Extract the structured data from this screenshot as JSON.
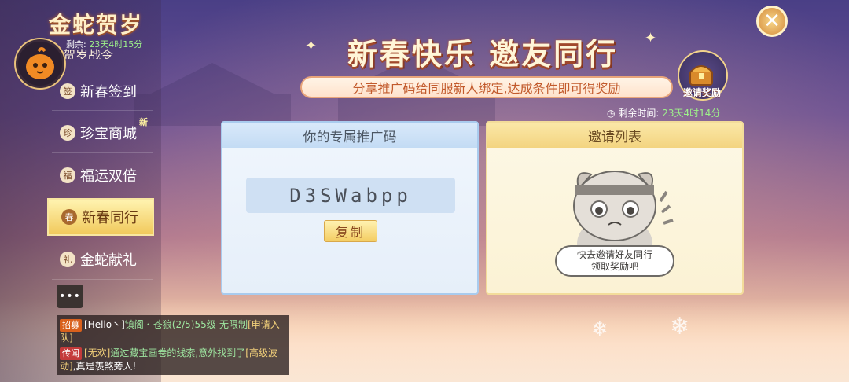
{
  "sidebar": {
    "title": "金蛇贺岁",
    "remaining_label": "剩余:",
    "remaining_value": "23天4时15分",
    "cut_off_item": "贺岁战令",
    "items": [
      {
        "label": "新春签到",
        "icon": "签"
      },
      {
        "label": "珍宝商城",
        "icon": "珍"
      },
      {
        "label": "福运双倍",
        "icon": "福"
      },
      {
        "label": "新春同行",
        "icon": "春"
      },
      {
        "label": "金蛇献礼",
        "icon": "礼"
      }
    ],
    "new_badge": "新",
    "active_item": "新春同行"
  },
  "chat": {
    "messages": [
      {
        "tag": "招募",
        "prefix": "[Hello丶]",
        "highlight": "镇阁・苍狼(2/5)55级-无限制",
        "suffix": "[申请入队]"
      },
      {
        "tag": "传闻",
        "prefix": "[无欢]",
        "highlight": "通过藏宝画卷的线索,意外找到了",
        "suffix": "[高级波动]",
        "end": ",真是羡煞旁人!"
      }
    ]
  },
  "header": {
    "title": "新春快乐  邀友同行",
    "subtitle": "分享推广码给同服新人绑定,达成条件即可得奖励",
    "reward_label": "邀请奖励",
    "remaining_label": "剩余时间:",
    "remaining_value": "23天4时14分"
  },
  "code_panel": {
    "title": "你的专属推广码",
    "code": "D3SWabpp",
    "copy_label": "复制"
  },
  "invite_panel": {
    "title": "邀请列表",
    "empty_line1": "快去邀请好友同行",
    "empty_line2": "领取奖励吧"
  },
  "icons": {
    "close": "close-icon",
    "chat": "chat-icon",
    "chest": "treasure-chest-icon",
    "clock": "clock-icon"
  },
  "colors": {
    "accent_gold": "#f1c95c",
    "remaining_green": "#9ef18a",
    "panel_blue": "#a9cbee",
    "panel_yellow": "#f3dc9a"
  }
}
